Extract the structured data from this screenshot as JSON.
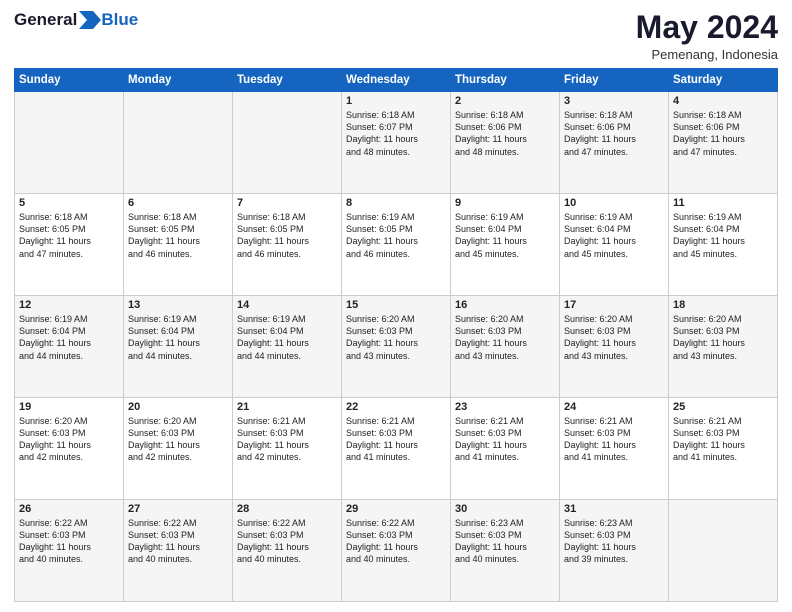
{
  "header": {
    "logo_general": "General",
    "logo_blue": "Blue",
    "month_year": "May 2024",
    "location": "Pemenang, Indonesia"
  },
  "days_of_week": [
    "Sunday",
    "Monday",
    "Tuesday",
    "Wednesday",
    "Thursday",
    "Friday",
    "Saturday"
  ],
  "weeks": [
    [
      {
        "day": "",
        "info": ""
      },
      {
        "day": "",
        "info": ""
      },
      {
        "day": "",
        "info": ""
      },
      {
        "day": "1",
        "info": "Sunrise: 6:18 AM\nSunset: 6:07 PM\nDaylight: 11 hours\nand 48 minutes."
      },
      {
        "day": "2",
        "info": "Sunrise: 6:18 AM\nSunset: 6:06 PM\nDaylight: 11 hours\nand 48 minutes."
      },
      {
        "day": "3",
        "info": "Sunrise: 6:18 AM\nSunset: 6:06 PM\nDaylight: 11 hours\nand 47 minutes."
      },
      {
        "day": "4",
        "info": "Sunrise: 6:18 AM\nSunset: 6:06 PM\nDaylight: 11 hours\nand 47 minutes."
      }
    ],
    [
      {
        "day": "5",
        "info": "Sunrise: 6:18 AM\nSunset: 6:05 PM\nDaylight: 11 hours\nand 47 minutes."
      },
      {
        "day": "6",
        "info": "Sunrise: 6:18 AM\nSunset: 6:05 PM\nDaylight: 11 hours\nand 46 minutes."
      },
      {
        "day": "7",
        "info": "Sunrise: 6:18 AM\nSunset: 6:05 PM\nDaylight: 11 hours\nand 46 minutes."
      },
      {
        "day": "8",
        "info": "Sunrise: 6:19 AM\nSunset: 6:05 PM\nDaylight: 11 hours\nand 46 minutes."
      },
      {
        "day": "9",
        "info": "Sunrise: 6:19 AM\nSunset: 6:04 PM\nDaylight: 11 hours\nand 45 minutes."
      },
      {
        "day": "10",
        "info": "Sunrise: 6:19 AM\nSunset: 6:04 PM\nDaylight: 11 hours\nand 45 minutes."
      },
      {
        "day": "11",
        "info": "Sunrise: 6:19 AM\nSunset: 6:04 PM\nDaylight: 11 hours\nand 45 minutes."
      }
    ],
    [
      {
        "day": "12",
        "info": "Sunrise: 6:19 AM\nSunset: 6:04 PM\nDaylight: 11 hours\nand 44 minutes."
      },
      {
        "day": "13",
        "info": "Sunrise: 6:19 AM\nSunset: 6:04 PM\nDaylight: 11 hours\nand 44 minutes."
      },
      {
        "day": "14",
        "info": "Sunrise: 6:19 AM\nSunset: 6:04 PM\nDaylight: 11 hours\nand 44 minutes."
      },
      {
        "day": "15",
        "info": "Sunrise: 6:20 AM\nSunset: 6:03 PM\nDaylight: 11 hours\nand 43 minutes."
      },
      {
        "day": "16",
        "info": "Sunrise: 6:20 AM\nSunset: 6:03 PM\nDaylight: 11 hours\nand 43 minutes."
      },
      {
        "day": "17",
        "info": "Sunrise: 6:20 AM\nSunset: 6:03 PM\nDaylight: 11 hours\nand 43 minutes."
      },
      {
        "day": "18",
        "info": "Sunrise: 6:20 AM\nSunset: 6:03 PM\nDaylight: 11 hours\nand 43 minutes."
      }
    ],
    [
      {
        "day": "19",
        "info": "Sunrise: 6:20 AM\nSunset: 6:03 PM\nDaylight: 11 hours\nand 42 minutes."
      },
      {
        "day": "20",
        "info": "Sunrise: 6:20 AM\nSunset: 6:03 PM\nDaylight: 11 hours\nand 42 minutes."
      },
      {
        "day": "21",
        "info": "Sunrise: 6:21 AM\nSunset: 6:03 PM\nDaylight: 11 hours\nand 42 minutes."
      },
      {
        "day": "22",
        "info": "Sunrise: 6:21 AM\nSunset: 6:03 PM\nDaylight: 11 hours\nand 41 minutes."
      },
      {
        "day": "23",
        "info": "Sunrise: 6:21 AM\nSunset: 6:03 PM\nDaylight: 11 hours\nand 41 minutes."
      },
      {
        "day": "24",
        "info": "Sunrise: 6:21 AM\nSunset: 6:03 PM\nDaylight: 11 hours\nand 41 minutes."
      },
      {
        "day": "25",
        "info": "Sunrise: 6:21 AM\nSunset: 6:03 PM\nDaylight: 11 hours\nand 41 minutes."
      }
    ],
    [
      {
        "day": "26",
        "info": "Sunrise: 6:22 AM\nSunset: 6:03 PM\nDaylight: 11 hours\nand 40 minutes."
      },
      {
        "day": "27",
        "info": "Sunrise: 6:22 AM\nSunset: 6:03 PM\nDaylight: 11 hours\nand 40 minutes."
      },
      {
        "day": "28",
        "info": "Sunrise: 6:22 AM\nSunset: 6:03 PM\nDaylight: 11 hours\nand 40 minutes."
      },
      {
        "day": "29",
        "info": "Sunrise: 6:22 AM\nSunset: 6:03 PM\nDaylight: 11 hours\nand 40 minutes."
      },
      {
        "day": "30",
        "info": "Sunrise: 6:23 AM\nSunset: 6:03 PM\nDaylight: 11 hours\nand 40 minutes."
      },
      {
        "day": "31",
        "info": "Sunrise: 6:23 AM\nSunset: 6:03 PM\nDaylight: 11 hours\nand 39 minutes."
      },
      {
        "day": "",
        "info": ""
      }
    ]
  ]
}
